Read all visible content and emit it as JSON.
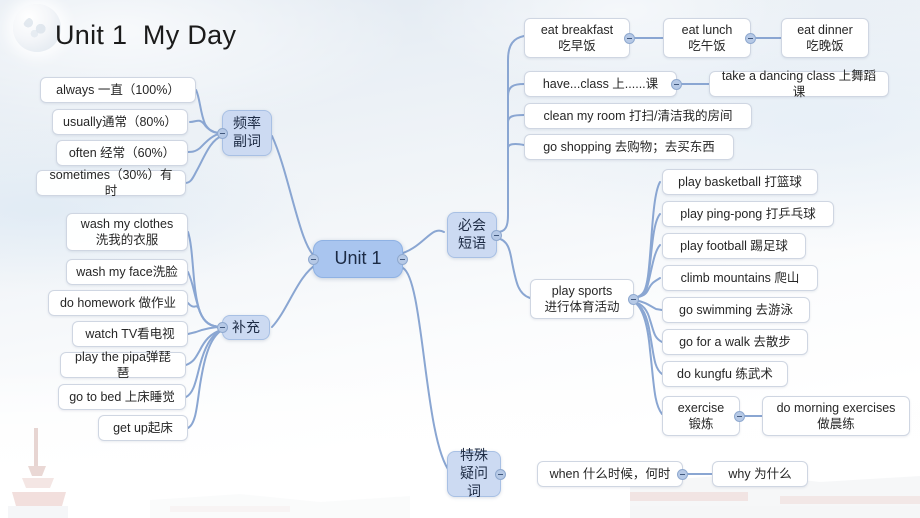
{
  "title": "Unit 1  My Day",
  "root": {
    "label": "Unit 1"
  },
  "branches": {
    "frequency": {
      "topic": "频率\n副词",
      "items": [
        {
          "label": "always  一直（100%）"
        },
        {
          "label": "usually通常（80%）"
        },
        {
          "label": "often 经常（60%）"
        },
        {
          "label": "sometimes（30%）有时"
        }
      ]
    },
    "supplement": {
      "topic": "补充",
      "items": [
        {
          "label": "wash my clothes\n洗我的衣服"
        },
        {
          "label": "wash my face洗脸"
        },
        {
          "label": "do homework 做作业"
        },
        {
          "label": "watch TV看电视"
        },
        {
          "label": "play the pipa弹琵琶"
        },
        {
          "label": "go to bed 上床睡觉"
        },
        {
          "label": "get  up起床"
        }
      ]
    },
    "phrases": {
      "topic": "必会\n短语",
      "items": [
        {
          "label": "eat breakfast\n吃早饭",
          "children": [
            {
              "label": "eat  lunch\n吃午饭",
              "children": [
                {
                  "label": "eat dinner\n吃晚饭"
                }
              ]
            }
          ]
        },
        {
          "label": "have...class 上......课",
          "children": [
            {
              "label": "take a dancing class 上舞蹈课"
            }
          ]
        },
        {
          "label": "clean my room 打扫/清洁我的房间"
        },
        {
          "label": "go shopping 去购物；去买东西"
        },
        {
          "label": "play sports\n进行体育活动",
          "children": [
            {
              "label": "play  basketball 打篮球"
            },
            {
              "label": "play ping-pong 打乒乓球"
            },
            {
              "label": "play football 踢足球"
            },
            {
              "label": "climb mountains 爬山"
            },
            {
              "label": "go swimming 去游泳"
            },
            {
              "label": "go for a walk 去散步"
            },
            {
              "label": "do kungfu 练武术"
            },
            {
              "label": "exercise\n锻炼",
              "children": [
                {
                  "label": "do morning exercises\n做晨练"
                }
              ]
            }
          ]
        }
      ]
    },
    "questionWords": {
      "topic": "特殊\n疑问词",
      "items": [
        {
          "label": "when 什么时候，何时",
          "children": [
            {
              "label": "why 为什么"
            }
          ]
        }
      ]
    }
  },
  "colors": {
    "link": "#8aa6d2",
    "root_fill": "#a9c5ef",
    "topic_fill": "#ccdaf2",
    "leaf_fill": "#ffffff",
    "leaf_border": "#cfd6e2",
    "text": "#262626"
  }
}
